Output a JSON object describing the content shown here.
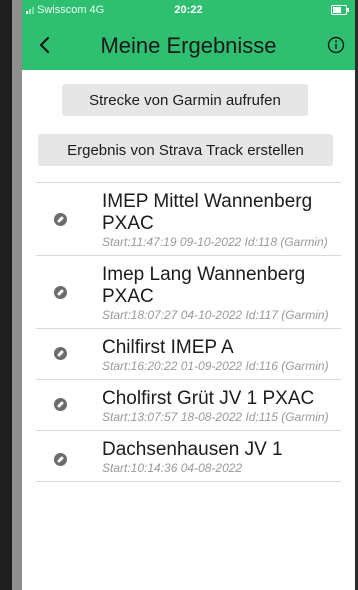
{
  "status_bar": {
    "carrier": "Swisscom",
    "network": "4G",
    "time": "20:22"
  },
  "nav": {
    "back_label": "<",
    "title": "Meine Ergebnisse",
    "info_icon": "info-icon"
  },
  "actions": {
    "garmin_label": "Strecke von Garmin aufrufen",
    "strava_label": "Ergebnis von Strava Track erstellen"
  },
  "results": [
    {
      "title": "IMEP Mittel Wannenberg PXAC",
      "subtitle": "Start:11:47:19 09-10-2022 Id:118 (Garmin)"
    },
    {
      "title": "Imep Lang Wannenberg PXAC",
      "subtitle": "Start:18:07:27 04-10-2022 Id:117 (Garmin)"
    },
    {
      "title": "Chilfirst IMEP A",
      "subtitle": "Start:16:20:22 01-09-2022 Id:116 (Garmin)"
    },
    {
      "title": "Cholfirst Grüt JV 1 PXAC",
      "subtitle": "Start:13:07:57 18-08-2022 Id:115 (Garmin)"
    },
    {
      "title": "Dachsenhausen JV 1",
      "subtitle": "Start:10:14:36 04-08-2022"
    }
  ],
  "colors": {
    "accent": "#2fbf70",
    "button_bg": "#e6e6e6",
    "subtitle": "#9a9a9a"
  }
}
